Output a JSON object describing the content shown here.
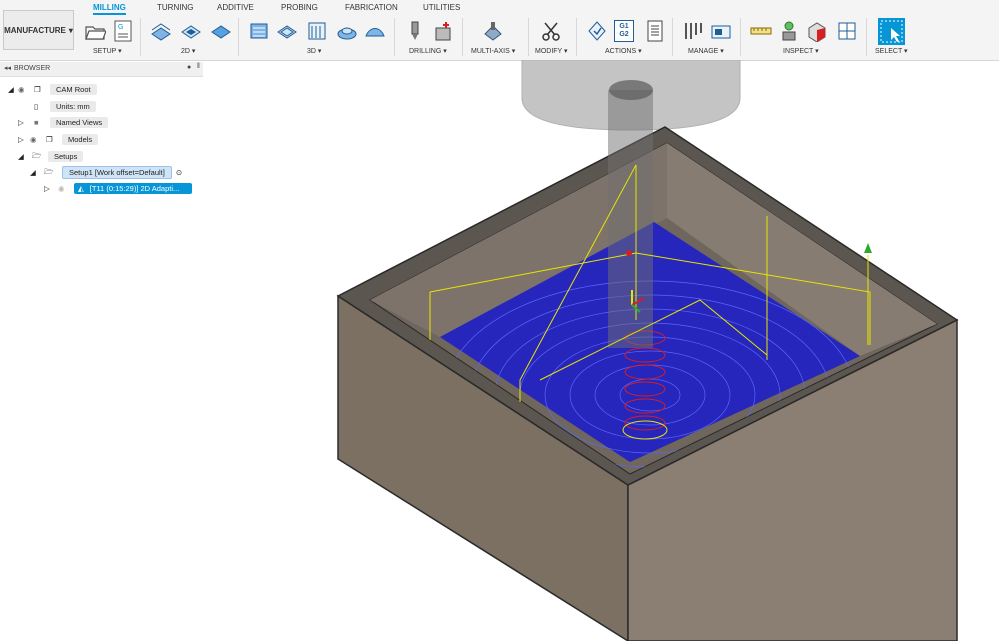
{
  "ribbon": {
    "workspace": "MANUFACTURE",
    "tabs": [
      {
        "label": "MILLING",
        "active": true
      },
      {
        "label": "TURNING"
      },
      {
        "label": "ADDITIVE"
      },
      {
        "label": "PROBING"
      },
      {
        "label": "FABRICATION"
      },
      {
        "label": "UTILITIES"
      }
    ],
    "groups": [
      "SETUP",
      "2D",
      "3D",
      "DRILLING",
      "MULTI-AXIS",
      "MODIFY",
      "ACTIONS",
      "MANAGE",
      "INSPECT",
      "SELECT"
    ],
    "actions_icon_text": [
      "G1",
      "G2"
    ]
  },
  "browser": {
    "title": "BROWSER",
    "items": [
      {
        "label": "CAM Root"
      },
      {
        "label": "Units: mm"
      },
      {
        "label": "Named Views"
      },
      {
        "label": "Models"
      },
      {
        "label": "Setups"
      },
      {
        "label": "Setup1 [Work offset=Default]"
      },
      {
        "label": "[T11 (0:15:29)] 2D Adapti..."
      }
    ]
  },
  "colors": {
    "accent": "#0696d7",
    "toolpath": "#1a1acc",
    "ramp": "#d81e1e",
    "rapid": "#e6e600",
    "stock": "#7a6e62"
  }
}
